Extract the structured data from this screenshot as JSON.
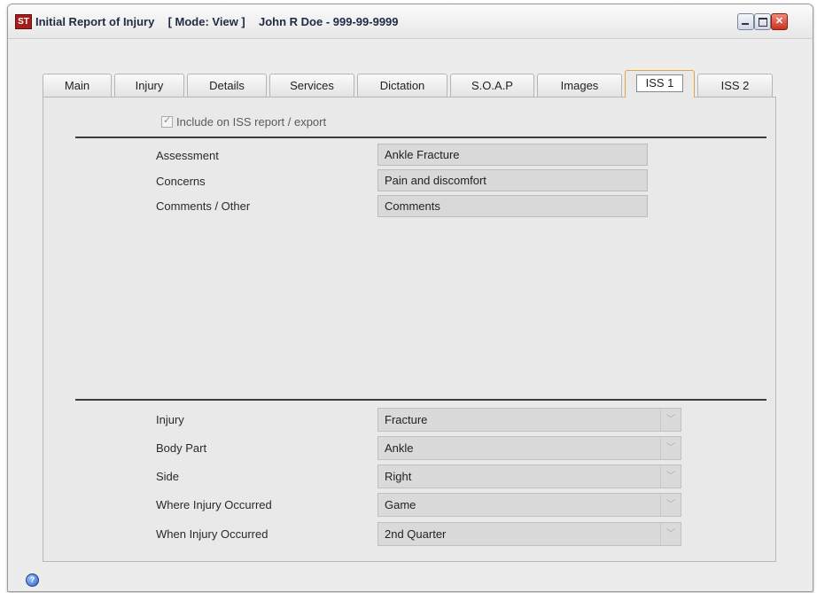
{
  "window": {
    "title_prefix": "Initial Report of Injury",
    "mode": "[ Mode: View ]",
    "patient": "John R Doe - 999-99-9999",
    "app_icon": "ST"
  },
  "tabs": [
    "Main",
    "Injury",
    "Details",
    "Services",
    "Dictation",
    "S.O.A.P",
    "Images",
    "ISS 1",
    "ISS 2"
  ],
  "active_tab": "ISS 1",
  "include_checkbox": {
    "label": "Include on ISS report / export",
    "checked": true
  },
  "top_fields": [
    {
      "label": "Assessment",
      "value": "Ankle Fracture"
    },
    {
      "label": "Concerns",
      "value": "Pain and discomfort"
    },
    {
      "label": "Comments / Other",
      "value": "Comments"
    }
  ],
  "bottom_fields": [
    {
      "label": "Injury",
      "value": "Fracture"
    },
    {
      "label": "Body Part",
      "value": "Ankle"
    },
    {
      "label": "Side",
      "value": "Right"
    },
    {
      "label": "Where Injury Occurred",
      "value": "Game"
    },
    {
      "label": "When Injury Occurred",
      "value": "2nd Quarter"
    }
  ],
  "icons": {
    "help": "help-icon",
    "dropdown": "chevron-down-icon"
  }
}
